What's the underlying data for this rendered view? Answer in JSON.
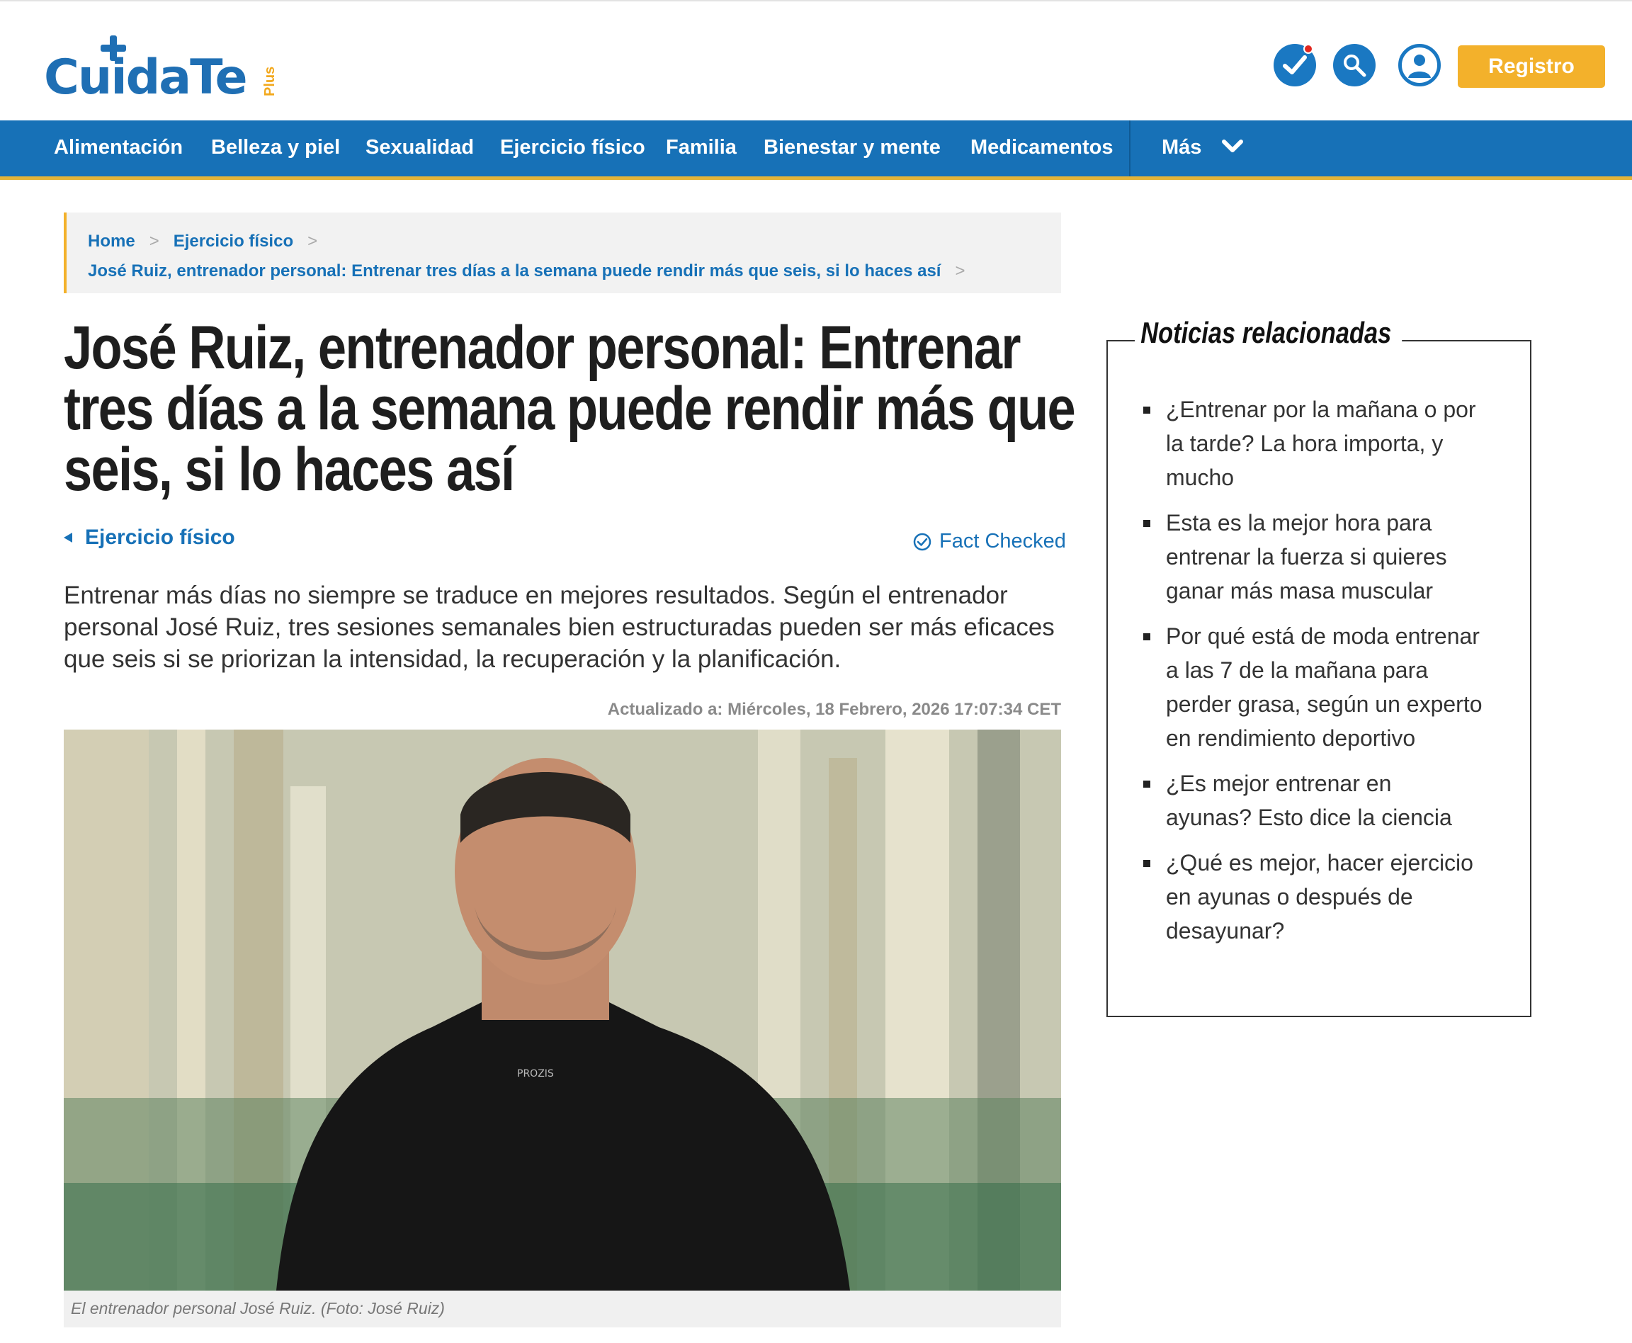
{
  "header": {
    "logo_main": "CuidaTe",
    "logo_sub": "Plus",
    "register_label": "Registro",
    "icons": [
      "check-notification-icon",
      "search-icon",
      "user-icon"
    ]
  },
  "nav": {
    "items": [
      "Alimentación",
      "Belleza y piel",
      "Sexualidad",
      "Ejercicio físico",
      "Familia",
      "Bienestar y mente",
      "Medicamentos"
    ],
    "more_label": "Más"
  },
  "breadcrumb": {
    "home": "Home",
    "section": "Ejercicio físico",
    "current": "José Ruiz, entrenador personal: Entrenar tres días a la semana puede rendir más que seis, si lo haces así"
  },
  "article": {
    "title": "José Ruiz, entrenador personal: Entrenar tres días a la semana puede rendir más que seis, si lo haces así",
    "section_tag": "Ejercicio físico",
    "fact_checked": "Fact Checked",
    "lead": "Entrenar más días no siempre se traduce en mejores resultados. Según el entrenador personal José Ruiz, tres sesiones semanales bien estructuradas pueden ser más eficaces que seis si se priorizan la intensidad, la recuperación y la planificación.",
    "updated": "Actualizado a: Miércoles, 18 Febrero, 2026 17:07:34 CET",
    "shirt_text": "PROZIS",
    "caption": "El entrenador personal José Ruiz. (Foto: José Ruiz)"
  },
  "related": {
    "title": "Noticias relacionadas",
    "items": [
      "¿Entrenar por la mañana o por la tarde? La hora importa, y mucho",
      "Esta es la mejor hora para entrenar la fuerza si quieres ganar más masa muscular",
      "Por qué está de moda entrenar a las 7 de la mañana para perder grasa, según un experto en rendimiento deportivo",
      "¿Es mejor entrenar en ayunas? Esto dice la ciencia",
      "¿Qué es mejor, hacer ejercicio en ayunas o después de desayunar?"
    ]
  },
  "colors": {
    "brand_blue": "#1771b7",
    "accent_yellow": "#f3b12b",
    "alert_red": "#e2271f"
  }
}
